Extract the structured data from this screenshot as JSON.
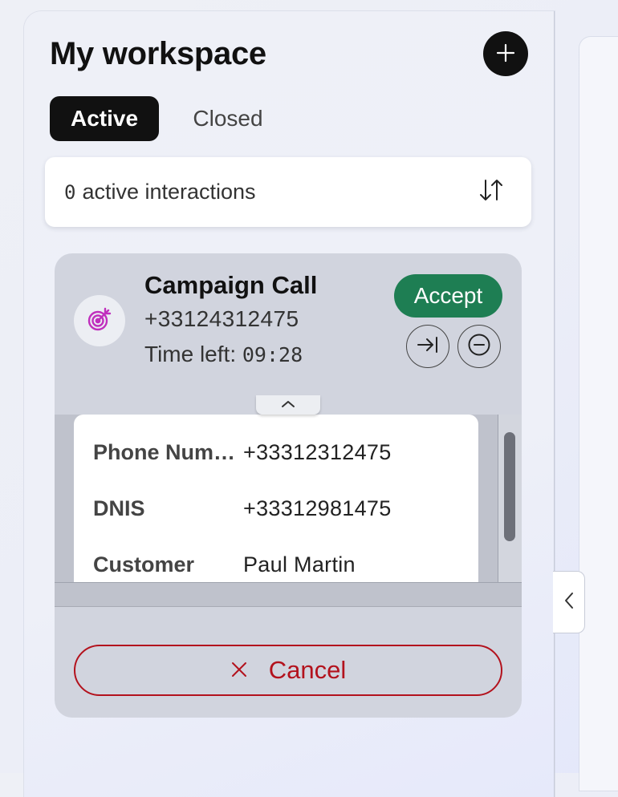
{
  "workspace": {
    "title": "My workspace",
    "add_icon": "plus-icon"
  },
  "tabs": [
    {
      "label": "Active",
      "selected": true
    },
    {
      "label": "Closed",
      "selected": false
    }
  ],
  "interactions_bar": {
    "count": "0",
    "label": "active interactions",
    "sort_icon": "sort-arrows-icon"
  },
  "interaction_card": {
    "avatar_icon": "target-icon",
    "title": "Campaign Call",
    "phone": "+33124312475",
    "time_left_label": "Time left:",
    "time_left_value": "09:28",
    "accept_label": "Accept",
    "transfer_icon": "arrow-to-line-icon",
    "reject_icon": "minus-circle-icon",
    "details": [
      {
        "label": "Phone Num…",
        "value": "+33312312475"
      },
      {
        "label": "DNIS",
        "value": "+33312981475"
      },
      {
        "label": "Customer",
        "value": "Paul Martin"
      }
    ],
    "cancel_label": "Cancel"
  },
  "colors": {
    "accept": "#1e7e53",
    "cancel": "#b3121d",
    "target_icon": "#c02fbd"
  }
}
